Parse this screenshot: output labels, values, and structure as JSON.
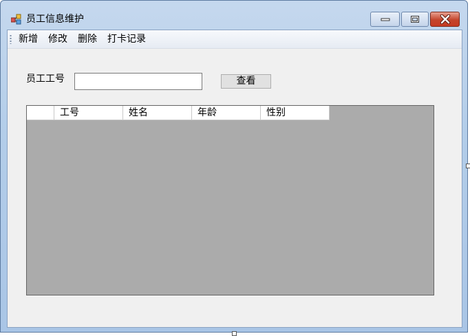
{
  "window": {
    "title": "员工信息维护",
    "icon": "app-window-icon",
    "controls": [
      "minimize-icon",
      "maximize-icon",
      "close-icon"
    ]
  },
  "menu": {
    "items": [
      {
        "label": "新增"
      },
      {
        "label": "修改"
      },
      {
        "label": "删除"
      },
      {
        "label": "打卡记录"
      }
    ]
  },
  "search": {
    "label": "员工工号",
    "value": "",
    "button": "查看"
  },
  "grid": {
    "columns": [
      "工号",
      "姓名",
      "年龄",
      "性别"
    ],
    "rows": [],
    "background": "#ababab"
  },
  "colors": {
    "titlebar": "#b3cde9",
    "client": "#f0f0f0",
    "close_button": "#c63a22"
  }
}
